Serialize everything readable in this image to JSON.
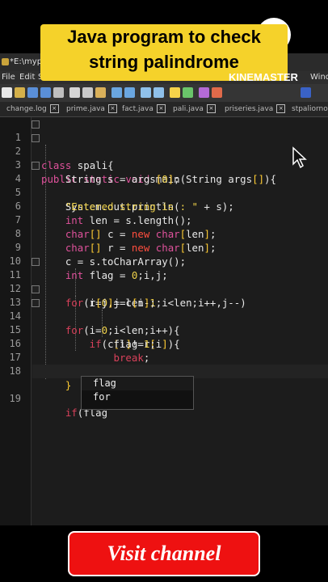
{
  "window": {
    "title": "*E:\\myprog\\spal"
  },
  "menu": {
    "items": [
      "File",
      "Edit",
      "Search",
      "Windo"
    ]
  },
  "tabs": [
    {
      "label": "change.log"
    },
    {
      "label": "prime.java"
    },
    {
      "label": "fact.java"
    },
    {
      "label": "pali.java"
    },
    {
      "label": "priseries.java"
    },
    {
      "label": "stpaliornot.java"
    }
  ],
  "overlay": {
    "headline_line1": "Java program to check",
    "headline_line2": "string palindrome",
    "watermark": "KINEMASTER",
    "cta_button": "Visit channel"
  },
  "editor": {
    "line_numbers": [
      "1",
      "2",
      "3",
      "4",
      "5",
      "6",
      "7",
      "8",
      "9",
      "10",
      "11",
      "12",
      "13",
      "14",
      "15",
      "16",
      "17",
      "18",
      "19"
    ]
  },
  "autocomplete": {
    "options": [
      "flag",
      "for"
    ]
  },
  "colors": {
    "headline_bg": "#f5d22a",
    "cta_bg": "#ee1111",
    "keyword": "#e0529c",
    "string": "#f0d24a",
    "new_kw": "#ff4e3e"
  }
}
